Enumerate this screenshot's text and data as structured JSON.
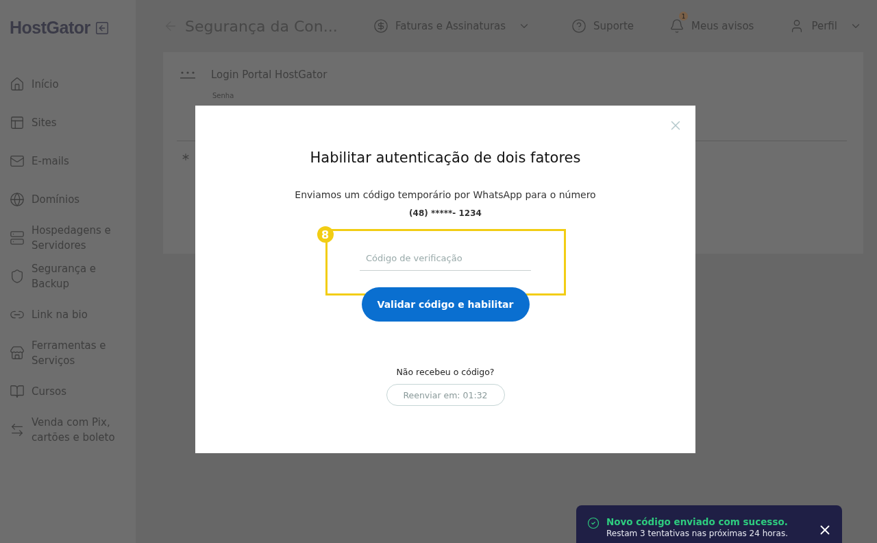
{
  "logo": "HostGator",
  "header": {
    "page_title": "Segurança da Con...",
    "nav": [
      {
        "label": "Faturas e Assinaturas",
        "dropdown": true
      },
      {
        "label": "Suporte",
        "dropdown": false
      },
      {
        "label": "Meus avisos",
        "dropdown": false,
        "badge": "1"
      },
      {
        "label": "Perfil",
        "dropdown": true
      }
    ]
  },
  "sidebar": {
    "items": [
      {
        "label": "Início"
      },
      {
        "label": "Sites"
      },
      {
        "label": "E-mails"
      },
      {
        "label": "Domínios"
      },
      {
        "label": "Hospedagens e Servidores"
      },
      {
        "label": "Segurança e Backup"
      },
      {
        "label": "Link na bio"
      },
      {
        "label": "Ferramentas e Serviços"
      },
      {
        "label": "Cursos"
      },
      {
        "label": "Venda com Pix, cartões e boleto"
      }
    ]
  },
  "card": {
    "title": "Login Portal HostGator",
    "field_label": "Senha"
  },
  "modal": {
    "title": "Habilitar autenticação de dois fatores",
    "message": "Enviamos um código temporário por WhatsApp para o número",
    "phone": "(48) *****- 1234",
    "code_field": {
      "placeholder": "Código de verificação"
    },
    "annotation": "8",
    "submit": "Validar código e habilitar",
    "resend_prompt": "Não recebeu o código?",
    "resend": {
      "label": "Reenviar em: 01:32",
      "disabled": true
    }
  },
  "toast": {
    "title": "Novo código enviado com sucesso.",
    "message": "Restam 3 tentativas nas próximas 24 horas."
  }
}
